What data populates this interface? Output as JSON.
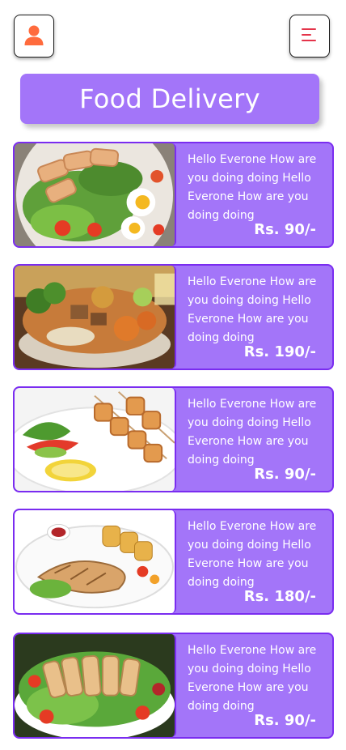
{
  "header": {
    "profile_icon": "user-icon",
    "menu_icon": "hamburger-menu-icon",
    "title": "Food Delivery"
  },
  "colors": {
    "accent": "#a375f9",
    "card_border": "#7a2cf0",
    "profile_icon": "#ff6b3d",
    "menu_icon": "#e4344a"
  },
  "items": [
    {
      "dish": "grilled-chicken-salad-with-eggs",
      "description": "Hello Everone How are you doing doing Hello Everone How are you doing doing",
      "price": "Rs. 90/-"
    },
    {
      "dish": "vegetable-buddha-bowl",
      "description": "Hello Everone How are you doing doing Hello Everone How are you doing doing",
      "price": "Rs. 190/-"
    },
    {
      "dish": "chicken-skewers-with-salad",
      "description": "Hello Everone How are you doing doing Hello Everone How are you doing doing",
      "price": "Rs. 90/-"
    },
    {
      "dish": "grilled-chicken-breast-with-potatoes",
      "description": "Hello Everone How are you doing doing Hello Everone How are you doing doing",
      "price": "Rs. 180/-"
    },
    {
      "dish": "sliced-chicken-salad-plate",
      "description": "Hello Everone How are you doing doing Hello Everone How are you doing doing",
      "price": "Rs. 90/-"
    }
  ]
}
